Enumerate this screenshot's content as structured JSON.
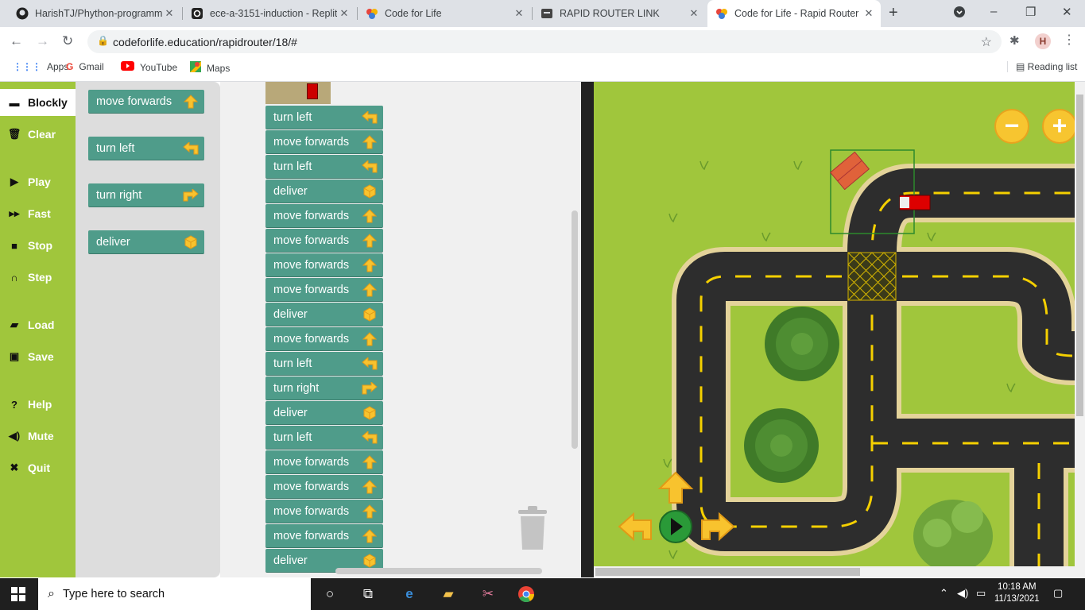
{
  "browser": {
    "tabs": [
      {
        "title": "HarishTJ/Phython-programm",
        "icon": "github-icon"
      },
      {
        "title": "ece-a-3151-induction - Replit",
        "icon": "replit-icon"
      },
      {
        "title": "Code for Life",
        "icon": "codeforlife-icon"
      },
      {
        "title": "RAPID ROUTER LINK",
        "icon": "page-icon"
      },
      {
        "title": "Code for Life - Rapid Router",
        "icon": "codeforlife-icon",
        "active": true
      }
    ],
    "url": "codeforlife.education/rapidrouter/18/#",
    "avatar": "H",
    "bookmarks": [
      {
        "label": "Apps",
        "icon": "apps-grid-icon"
      },
      {
        "label": "Gmail",
        "icon": "gmail-icon"
      },
      {
        "label": "YouTube",
        "icon": "youtube-icon"
      },
      {
        "label": "Maps",
        "icon": "maps-icon"
      }
    ],
    "reading_list": "Reading list"
  },
  "sidebar": {
    "items": [
      {
        "label": "Blockly",
        "icon": "blockly-icon",
        "active": true
      },
      {
        "label": "Clear",
        "icon": "trash-icon"
      },
      {
        "label": "Play",
        "icon": "play-icon"
      },
      {
        "label": "Fast",
        "icon": "fast-forward-icon"
      },
      {
        "label": "Stop",
        "icon": "stop-icon"
      },
      {
        "label": "Step",
        "icon": "step-icon"
      },
      {
        "label": "Load",
        "icon": "folder-icon"
      },
      {
        "label": "Save",
        "icon": "save-icon"
      },
      {
        "label": "Help",
        "icon": "help-icon"
      },
      {
        "label": "Mute",
        "icon": "speaker-icon"
      },
      {
        "label": "Quit",
        "icon": "close-icon"
      }
    ]
  },
  "flyout": {
    "blocks": [
      {
        "label": "move forwards",
        "icon": "arrow-up-icon"
      },
      {
        "label": "turn left",
        "icon": "arrow-left-icon"
      },
      {
        "label": "turn right",
        "icon": "arrow-right-icon"
      },
      {
        "label": "deliver",
        "icon": "box-icon"
      }
    ]
  },
  "program": {
    "blocks": [
      {
        "label": "turn left",
        "icon": "arrow-left-icon"
      },
      {
        "label": "move forwards",
        "icon": "arrow-up-icon"
      },
      {
        "label": "turn left",
        "icon": "arrow-left-icon"
      },
      {
        "label": "deliver",
        "icon": "box-icon"
      },
      {
        "label": "move forwards",
        "icon": "arrow-up-icon"
      },
      {
        "label": "move forwards",
        "icon": "arrow-up-icon"
      },
      {
        "label": "move forwards",
        "icon": "arrow-up-icon"
      },
      {
        "label": "move forwards",
        "icon": "arrow-up-icon"
      },
      {
        "label": "deliver",
        "icon": "box-icon"
      },
      {
        "label": "move forwards",
        "icon": "arrow-up-icon"
      },
      {
        "label": "turn left",
        "icon": "arrow-left-icon"
      },
      {
        "label": "turn right",
        "icon": "arrow-right-icon"
      },
      {
        "label": "deliver",
        "icon": "box-icon"
      },
      {
        "label": "turn left",
        "icon": "arrow-left-icon"
      },
      {
        "label": "move forwards",
        "icon": "arrow-up-icon"
      },
      {
        "label": "move forwards",
        "icon": "arrow-up-icon"
      },
      {
        "label": "move forwards",
        "icon": "arrow-up-icon"
      },
      {
        "label": "move forwards",
        "icon": "arrow-up-icon"
      },
      {
        "label": "deliver",
        "icon": "box-icon"
      }
    ]
  },
  "map": {
    "zoom_out": "−",
    "zoom_in": "+",
    "colors": {
      "grass": "#a0c63c",
      "road": "#2d2d2d",
      "curb": "#e4d39a",
      "lane": "#f5d000",
      "button": "#f7c530"
    }
  },
  "taskbar": {
    "search_placeholder": "Type here to search",
    "time": "10:18 AM",
    "date": "11/13/2021"
  }
}
